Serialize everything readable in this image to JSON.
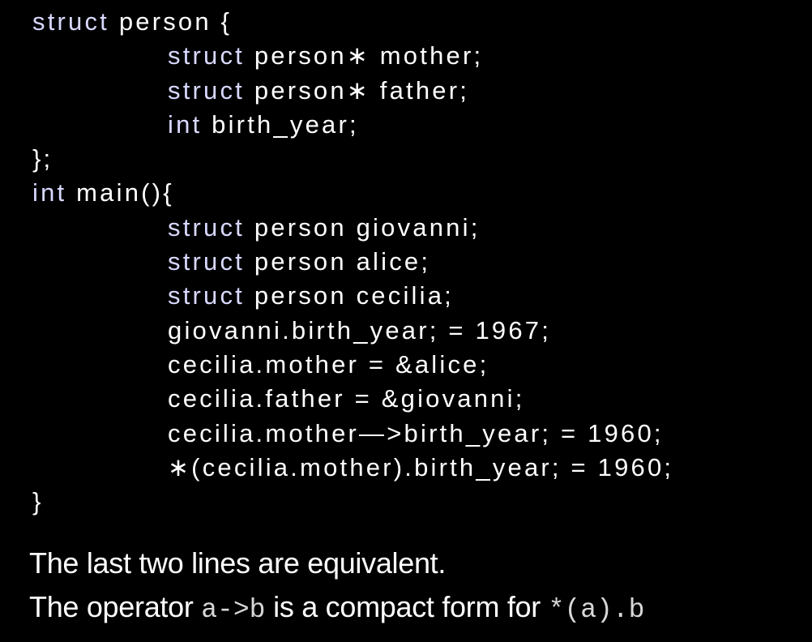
{
  "code": {
    "lines": [
      {
        "indent": false,
        "parts": [
          {
            "kw": true,
            "text": "struct"
          },
          {
            "kw": false,
            "text": " person {"
          }
        ]
      },
      {
        "indent": true,
        "parts": [
          {
            "kw": true,
            "text": "struct"
          },
          {
            "kw": false,
            "text": " person∗ mother;"
          }
        ]
      },
      {
        "indent": true,
        "parts": [
          {
            "kw": true,
            "text": "struct"
          },
          {
            "kw": false,
            "text": " person∗ father;"
          }
        ]
      },
      {
        "indent": true,
        "parts": [
          {
            "kw": true,
            "text": "int"
          },
          {
            "kw": false,
            "text": " birth_year;"
          }
        ]
      },
      {
        "indent": false,
        "parts": [
          {
            "kw": false,
            "text": "};"
          }
        ]
      },
      {
        "indent": false,
        "parts": [
          {
            "kw": true,
            "text": "int"
          },
          {
            "kw": false,
            "text": " main(){"
          }
        ]
      },
      {
        "indent": true,
        "parts": [
          {
            "kw": true,
            "text": "struct"
          },
          {
            "kw": false,
            "text": " person giovanni;"
          }
        ]
      },
      {
        "indent": true,
        "parts": [
          {
            "kw": true,
            "text": "struct"
          },
          {
            "kw": false,
            "text": " person alice;"
          }
        ]
      },
      {
        "indent": true,
        "parts": [
          {
            "kw": true,
            "text": "struct"
          },
          {
            "kw": false,
            "text": " person cecilia;"
          }
        ]
      },
      {
        "indent": true,
        "parts": [
          {
            "kw": false,
            "text": "giovanni.birth_year; = 1967;"
          }
        ]
      },
      {
        "indent": true,
        "parts": [
          {
            "kw": false,
            "text": "cecilia.mother = &alice;"
          }
        ]
      },
      {
        "indent": true,
        "parts": [
          {
            "kw": false,
            "text": "cecilia.father = &giovanni;"
          }
        ]
      },
      {
        "indent": true,
        "parts": [
          {
            "kw": false,
            "text": "cecilia.mother—>birth_year; = 1960;"
          }
        ]
      },
      {
        "indent": true,
        "parts": [
          {
            "kw": false,
            "text": "∗(cecilia.mother).birth_year; = 1960;"
          }
        ]
      },
      {
        "indent": false,
        "parts": [
          {
            "kw": false,
            "text": "}"
          }
        ]
      }
    ]
  },
  "explanation": {
    "line1": "The last two lines are equivalent.",
    "line2_prefix": "The operator ",
    "line2_code1": "a->b",
    "line2_middle": " is a compact form for ",
    "line2_code2": "*(a).b"
  },
  "colors": {
    "background": "#000000",
    "text": "#ffffff",
    "keyword": "#d8d8ff"
  }
}
